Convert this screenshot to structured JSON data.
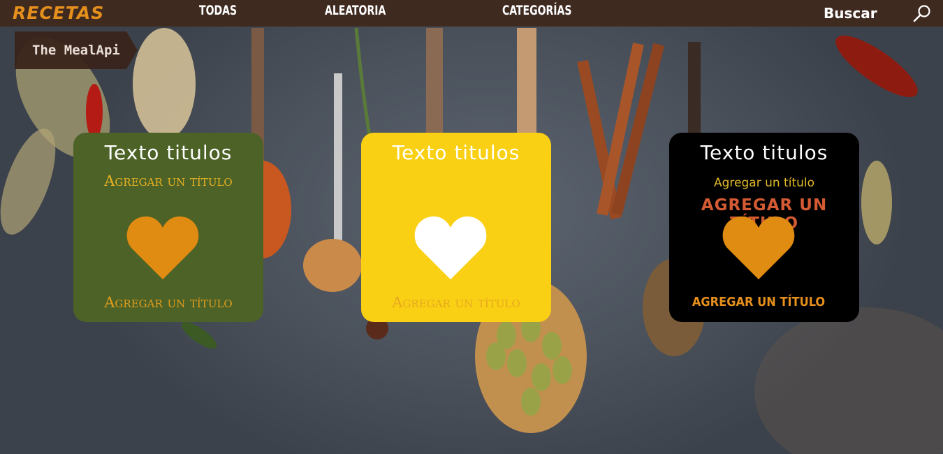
{
  "colors": {
    "nav_background": "#3f2a20",
    "brand": "#e58f1c",
    "card_green": "#4c6226",
    "card_yellow": "#f9d013",
    "card_black": "#000000",
    "heart_orange": "#e08b12",
    "heart_white": "#ffffff"
  },
  "header": {
    "brand": "RECETAS",
    "nav": {
      "todas": "TODAS",
      "aleatoria": "ALEATORIA",
      "categorias": "CATEGORÍAS"
    },
    "search_label": "Buscar",
    "search_icon": "search-icon"
  },
  "ribbon": {
    "label": "The MealApi"
  },
  "cards": [
    {
      "title": "Texto titulos",
      "subtitle": "Agregar un título",
      "heart_icon": "heart-icon",
      "bottom_text": "Agregar un título"
    },
    {
      "title": "Texto titulos",
      "heart_icon": "heart-icon",
      "bottom_text": "Agregar un título"
    },
    {
      "title": "Texto titulos",
      "subtitle_small": "Agregar un título",
      "subtitle_big": "AGREGAR UN TÍTULO",
      "heart_icon": "heart-icon",
      "bottom_text": "AGREGAR UN TÍTULO"
    }
  ]
}
